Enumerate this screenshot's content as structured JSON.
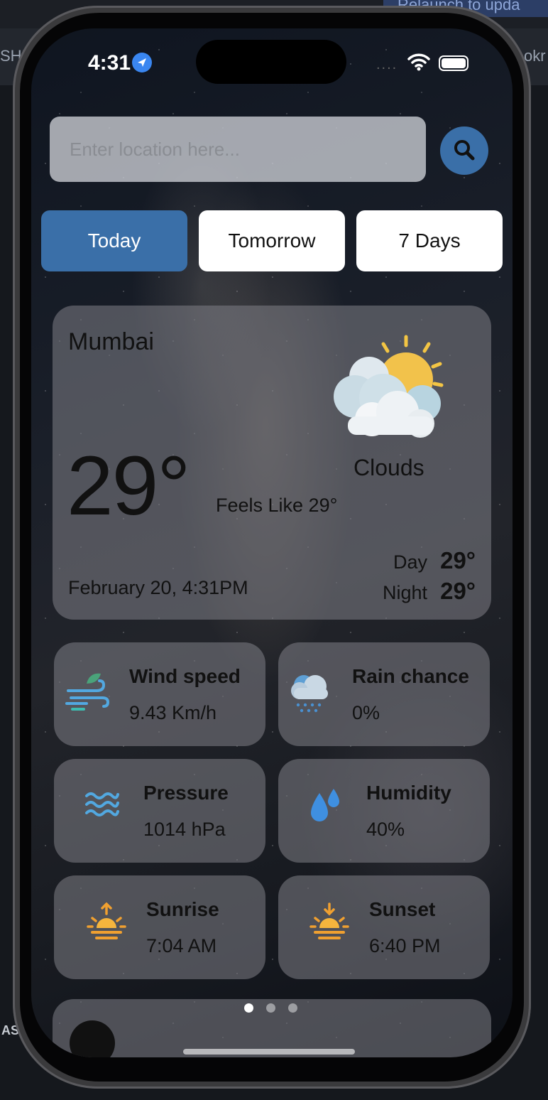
{
  "status_bar": {
    "time": "4:31",
    "dots": "...."
  },
  "search": {
    "placeholder": "Enter location here..."
  },
  "tabs": [
    {
      "label": "Today",
      "active": true
    },
    {
      "label": "Tomorrow",
      "active": false
    },
    {
      "label": "7 Days",
      "active": false
    }
  ],
  "current": {
    "city": "Mumbai",
    "temperature": "29°",
    "condition": "Clouds",
    "feels_like": "Feels Like 29°",
    "datetime": "February 20, 4:31PM",
    "day_label": "Day",
    "day_temp": "29°",
    "night_label": "Night",
    "night_temp": "29°"
  },
  "stats": [
    {
      "title": "Wind speed",
      "value": "9.43 Km/h",
      "icon": "wind-icon"
    },
    {
      "title": "Rain chance",
      "value": "0%",
      "icon": "rain-cloud-icon"
    },
    {
      "title": "Pressure",
      "value": "1014 hPa",
      "icon": "waves-icon"
    },
    {
      "title": "Humidity",
      "value": "40%",
      "icon": "droplets-icon"
    },
    {
      "title": "Sunrise",
      "value": "7:04 AM",
      "icon": "sunrise-icon"
    },
    {
      "title": "Sunset",
      "value": "6:40 PM",
      "icon": "sunset-icon"
    }
  ],
  "pager": {
    "count": 3,
    "active_index": 0
  },
  "colors": {
    "accent": "#3a6fa8",
    "card": "#808086"
  },
  "background": {
    "relaunch_text": "Relaunch to upda",
    "left_text": "SHE",
    "right_text": "okr",
    "bottom_text": "AS"
  }
}
